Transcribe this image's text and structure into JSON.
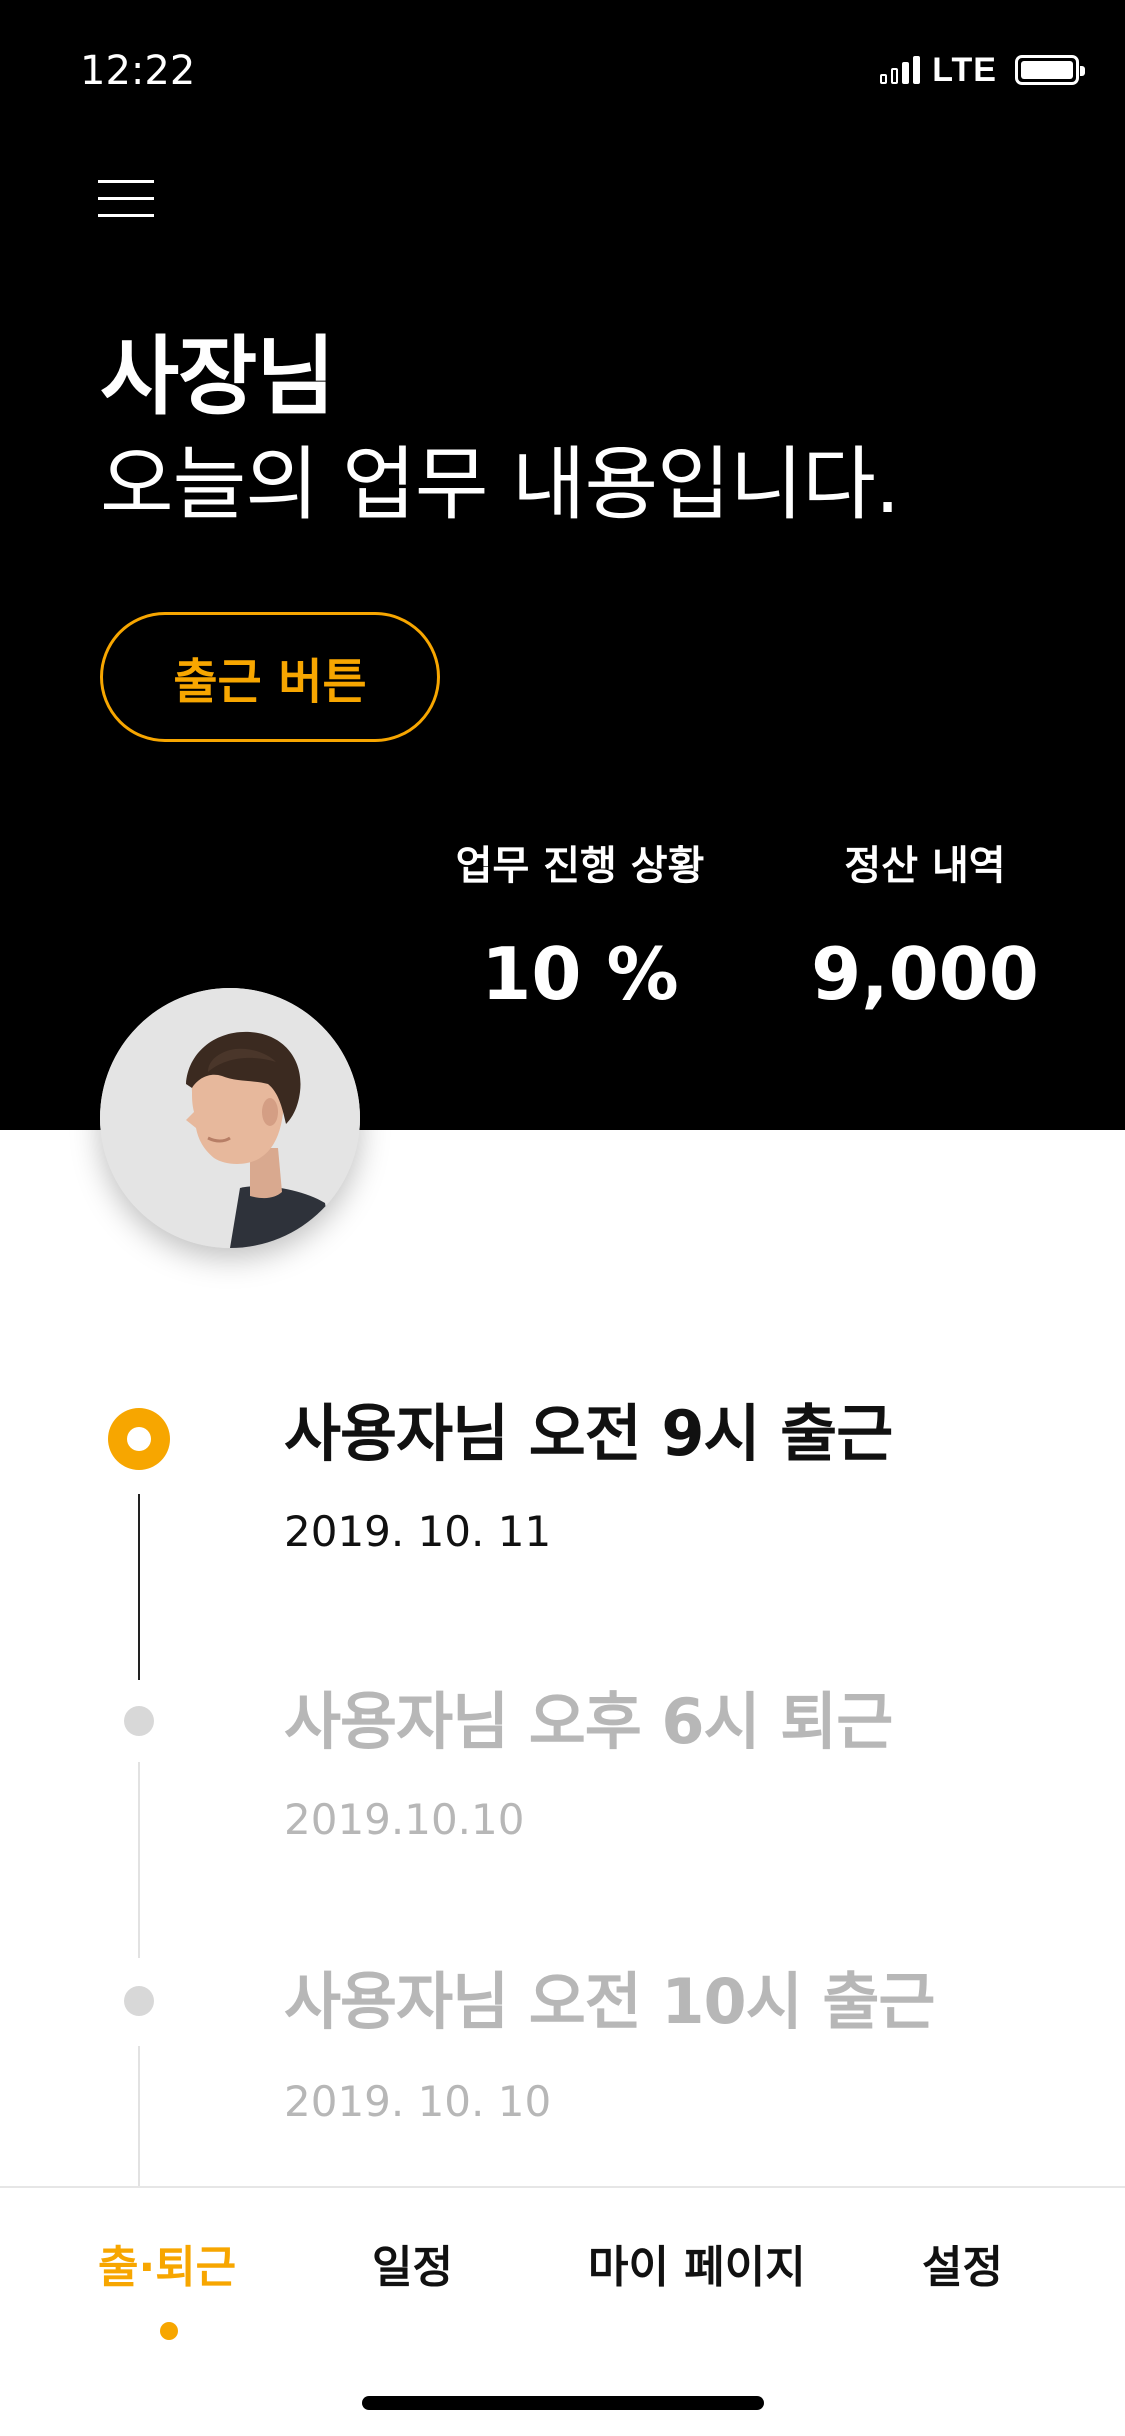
{
  "status_bar": {
    "time": "12:22",
    "network": "LTE"
  },
  "header": {
    "greeting_name": "사장님",
    "greeting_sub": "오늘의 업무 내용입니다.",
    "checkin_button_label": "출근 버튼"
  },
  "stats": {
    "progress_label": "업무 진행 상황",
    "progress_value": "10 %",
    "settlement_label": "정산 내역",
    "settlement_value": "9,000"
  },
  "timeline": [
    {
      "title": "사용자님 오전 9시 출근",
      "date": "2019. 10. 11"
    },
    {
      "title": "사용자님 오후 6시 퇴근",
      "date": "2019.10.10"
    },
    {
      "title": "사용자님 오전 10시 출근",
      "date": "2019. 10. 10"
    }
  ],
  "bottom_nav": {
    "items": [
      "출·퇴근",
      "일정",
      "마이 페이지",
      "설정"
    ],
    "active": "출·퇴근"
  },
  "colors": {
    "accent": "#f7a600",
    "header_bg": "#000000",
    "muted_text": "#b7b7b7"
  },
  "icons": {
    "menu": "hamburger-menu-icon",
    "signal": "signal-icon",
    "battery": "battery-icon"
  }
}
